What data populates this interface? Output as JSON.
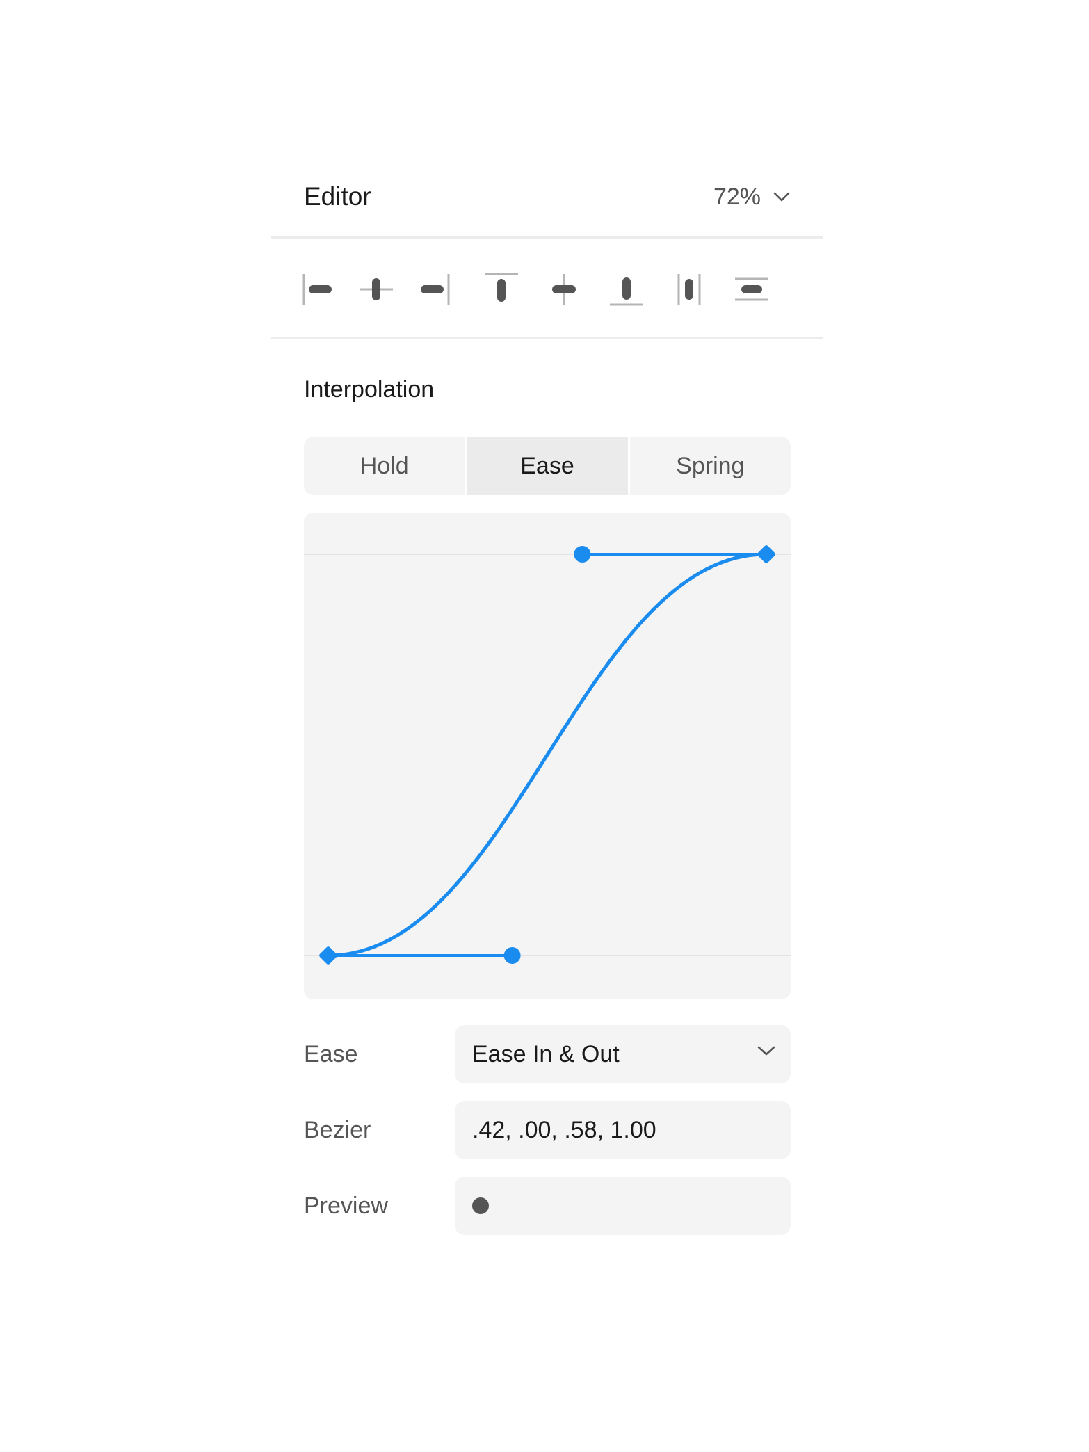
{
  "header": {
    "title": "Editor",
    "zoom_value": "72%",
    "zoom_icon": "chevron-down-icon"
  },
  "align_toolbar": {
    "buttons": [
      {
        "name": "align-left",
        "icon": "align-left-icon"
      },
      {
        "name": "align-horizontal-center",
        "icon": "align-horizontal-center-icon"
      },
      {
        "name": "align-right",
        "icon": "align-right-icon"
      },
      {
        "name": "align-top",
        "icon": "align-top-icon"
      },
      {
        "name": "align-vertical-center",
        "icon": "align-vertical-center-icon"
      },
      {
        "name": "align-bottom",
        "icon": "align-bottom-icon"
      },
      {
        "name": "distribute-horizontal",
        "icon": "distribute-horizontal-icon"
      },
      {
        "name": "distribute-vertical",
        "icon": "distribute-vertical-icon"
      }
    ]
  },
  "interpolation": {
    "title": "Interpolation",
    "segments": [
      "Hold",
      "Ease",
      "Spring"
    ],
    "selected": "Ease"
  },
  "curve": {
    "bezier": [
      0.42,
      0.0,
      0.58,
      1.0
    ],
    "accent_color": "#1a8cf0"
  },
  "properties": {
    "ease": {
      "label": "Ease",
      "value": "Ease In & Out",
      "icon": "chevron-down-icon"
    },
    "bezier": {
      "label": "Bezier",
      "value": ".42, .00, .58, 1.00"
    },
    "preview": {
      "label": "Preview"
    }
  },
  "colors": {
    "accent": "#1a8cf0",
    "field_bg": "#f4f4f4",
    "icon": "#555555",
    "divider": "#ececec"
  }
}
